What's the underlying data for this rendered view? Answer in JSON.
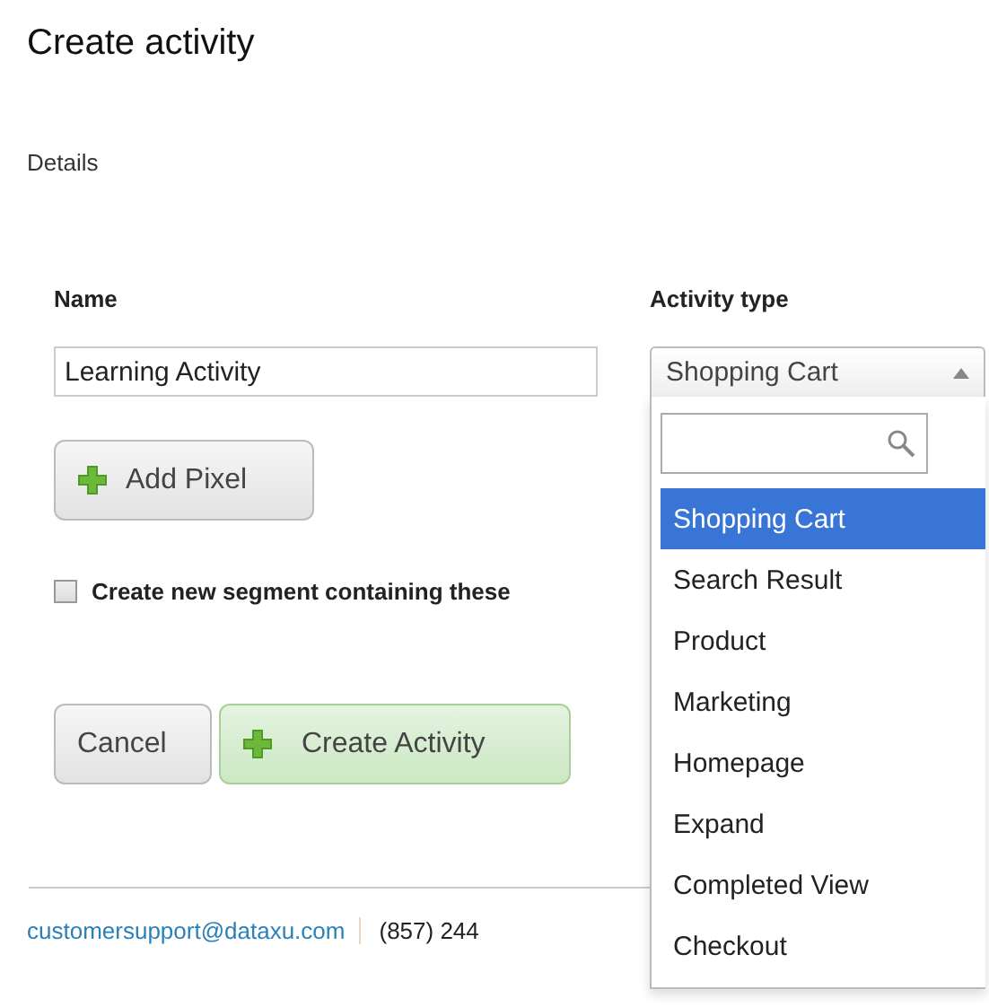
{
  "title": "Create activity",
  "section": "Details",
  "name_field": {
    "label": "Name",
    "value": "Learning Activity"
  },
  "add_button": {
    "label": "Add Pixel"
  },
  "segment_checkbox": {
    "label": "Create new segment containing these",
    "checked": false
  },
  "buttons": [
    {
      "label": "Cancel",
      "kind": "plain"
    },
    {
      "label": "Create Activity",
      "kind": "primary"
    }
  ],
  "activity_type": {
    "label": "Activity type",
    "value": "Shopping Cart",
    "expanded": true,
    "options": [
      {
        "label": "Shopping Cart",
        "selected": true
      },
      {
        "label": "Search Result",
        "selected": false
      },
      {
        "label": "Product",
        "selected": false
      },
      {
        "label": "Marketing",
        "selected": false
      },
      {
        "label": "Homepage",
        "selected": false
      },
      {
        "label": "Expand",
        "selected": false
      },
      {
        "label": "Completed View",
        "selected": false
      },
      {
        "label": "Checkout",
        "selected": false
      }
    ]
  },
  "footer": {
    "email": "customersupport@dataxu.com",
    "phone": "(857) 244"
  }
}
